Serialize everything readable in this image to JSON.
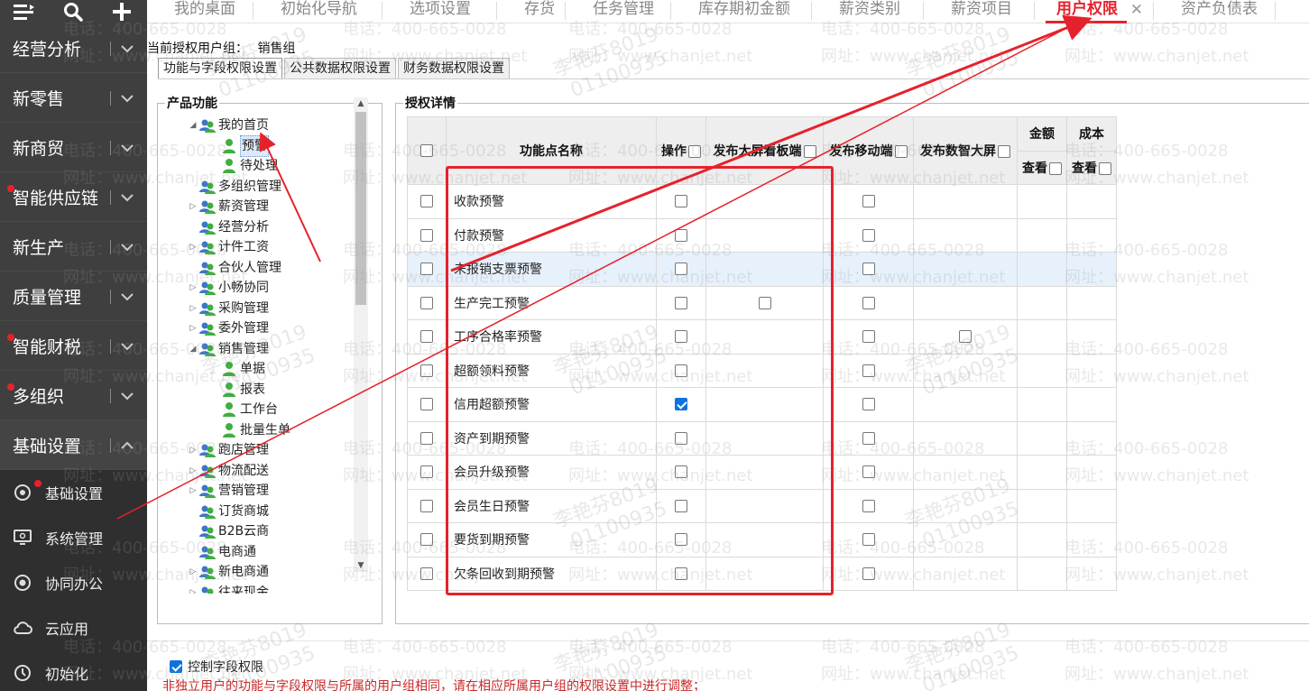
{
  "sidebar": {
    "groups": [
      {
        "label": "经营分析",
        "dot": false
      },
      {
        "label": "新零售",
        "dot": false
      },
      {
        "label": "新商贸",
        "dot": false
      },
      {
        "label": "智能供应链",
        "dot": true
      },
      {
        "label": "新生产",
        "dot": false
      },
      {
        "label": "质量管理",
        "dot": false
      },
      {
        "label": "智能财税",
        "dot": true
      },
      {
        "label": "多组织",
        "dot": true
      },
      {
        "label": "基础设置",
        "dot": false
      }
    ],
    "subitems": [
      {
        "label": "基础设置",
        "icon": "settings-icon",
        "dot": true
      },
      {
        "label": "系统管理",
        "icon": "monitor-settings-icon",
        "dot": false
      },
      {
        "label": "协同办公",
        "icon": "collaboration-icon",
        "dot": false
      },
      {
        "label": "云应用",
        "icon": "cloud-icon",
        "dot": false
      },
      {
        "label": "初始化",
        "icon": "init-icon",
        "dot": false
      }
    ]
  },
  "tabs": [
    {
      "label": "我的桌面",
      "active": false
    },
    {
      "label": "初始化导航",
      "active": false
    },
    {
      "label": "选项设置",
      "active": false
    },
    {
      "label": "存货",
      "active": false
    },
    {
      "label": "任务管理",
      "active": false
    },
    {
      "label": "库存期初金额",
      "active": false
    },
    {
      "label": "薪资类别",
      "active": false
    },
    {
      "label": "薪资项目",
      "active": false
    },
    {
      "label": "用户权限",
      "active": true
    },
    {
      "label": "资产负债表",
      "active": false
    }
  ],
  "content": {
    "group_label": "当前授权用户组：",
    "group_value": "销售组",
    "subtabs": [
      "功能与字段权限设置",
      "公共数据权限设置",
      "财务数据权限设置"
    ],
    "tree_title": "产品功能",
    "detail_title": "授权详情",
    "tree": [
      {
        "label": "我的首页",
        "level": 0,
        "arrow": "open"
      },
      {
        "label": "预警",
        "level": 1,
        "arrow": "",
        "selected": true
      },
      {
        "label": "待处理",
        "level": 1,
        "arrow": ""
      },
      {
        "label": "多组织管理",
        "level": 0,
        "arrow": ""
      },
      {
        "label": "薪资管理",
        "level": 0,
        "arrow": "closed"
      },
      {
        "label": "经营分析",
        "level": 0,
        "arrow": ""
      },
      {
        "label": "计件工资",
        "level": 0,
        "arrow": "closed"
      },
      {
        "label": "合伙人管理",
        "level": 0,
        "arrow": ""
      },
      {
        "label": "小畅协同",
        "level": 0,
        "arrow": "closed"
      },
      {
        "label": "采购管理",
        "level": 0,
        "arrow": "closed"
      },
      {
        "label": "委外管理",
        "level": 0,
        "arrow": "closed"
      },
      {
        "label": "销售管理",
        "level": 0,
        "arrow": "open"
      },
      {
        "label": "单据",
        "level": 1,
        "arrow": ""
      },
      {
        "label": "报表",
        "level": 1,
        "arrow": ""
      },
      {
        "label": "工作台",
        "level": 1,
        "arrow": ""
      },
      {
        "label": "批量生单",
        "level": 1,
        "arrow": ""
      },
      {
        "label": "跑店管理",
        "level": 0,
        "arrow": "closed"
      },
      {
        "label": "物流配送",
        "level": 0,
        "arrow": "closed"
      },
      {
        "label": "营销管理",
        "level": 0,
        "arrow": "closed"
      },
      {
        "label": "订货商城",
        "level": 0,
        "arrow": ""
      },
      {
        "label": "B2B云商",
        "level": 0,
        "arrow": ""
      },
      {
        "label": "电商通",
        "level": 0,
        "arrow": ""
      },
      {
        "label": "新电商通",
        "level": 0,
        "arrow": "closed"
      },
      {
        "label": "往来现金",
        "level": 0,
        "arrow": "closed"
      }
    ],
    "grid": {
      "headers": {
        "name": "功能点名称",
        "operate": "操作",
        "bigscreen": "发布大屏看板端",
        "mobile": "发布移动端",
        "datascreen": "发布数智大屏",
        "amount": "金额",
        "cost": "成本",
        "view": "查看"
      },
      "rows": [
        {
          "name": "收款预警",
          "op": "unchecked",
          "big": "",
          "mob": "unchecked",
          "ds": "",
          "hl": false
        },
        {
          "name": "付款预警",
          "op": "unchecked",
          "big": "",
          "mob": "unchecked",
          "ds": "",
          "hl": false
        },
        {
          "name": "未报销支票预警",
          "op": "unchecked",
          "big": "",
          "mob": "unchecked",
          "ds": "",
          "hl": true
        },
        {
          "name": "生产完工预警",
          "op": "unchecked",
          "big": "unchecked",
          "mob": "unchecked",
          "ds": "",
          "hl": false
        },
        {
          "name": "工序合格率预警",
          "op": "unchecked",
          "big": "",
          "mob": "unchecked",
          "ds": "unchecked",
          "hl": false
        },
        {
          "name": "超额领料预警",
          "op": "unchecked",
          "big": "",
          "mob": "unchecked",
          "ds": "",
          "hl": false
        },
        {
          "name": "信用超额预警",
          "op": "checked",
          "big": "",
          "mob": "unchecked",
          "ds": "",
          "hl": false
        },
        {
          "name": "资产到期预警",
          "op": "unchecked",
          "big": "",
          "mob": "unchecked",
          "ds": "",
          "hl": false
        },
        {
          "name": "会员升级预警",
          "op": "unchecked",
          "big": "",
          "mob": "unchecked",
          "ds": "",
          "hl": false
        },
        {
          "name": "会员生日预警",
          "op": "unchecked",
          "big": "",
          "mob": "unchecked",
          "ds": "",
          "hl": false
        },
        {
          "name": "要货到期预警",
          "op": "unchecked",
          "big": "",
          "mob": "unchecked",
          "ds": "",
          "hl": false
        },
        {
          "name": "欠条回收到期预警",
          "op": "unchecked",
          "big": "",
          "mob": "unchecked",
          "ds": "",
          "hl": false
        }
      ]
    },
    "field_control_label": "控制字段权限",
    "field_control_checked": true,
    "note": "非独立用户的功能与字段权限与所属的用户组相同，请在相应所属用户组的权限设置中进行调整；"
  },
  "watermark": {
    "phone": "电话：400-665-0028",
    "site": "网址：www.chanjet.net",
    "name": "李艳芬8019",
    "code": "01100935"
  },
  "colors": {
    "accent": "#e5222b",
    "sidebar": "#3f3f3f",
    "checkbox_checked": "#0b74e0"
  }
}
